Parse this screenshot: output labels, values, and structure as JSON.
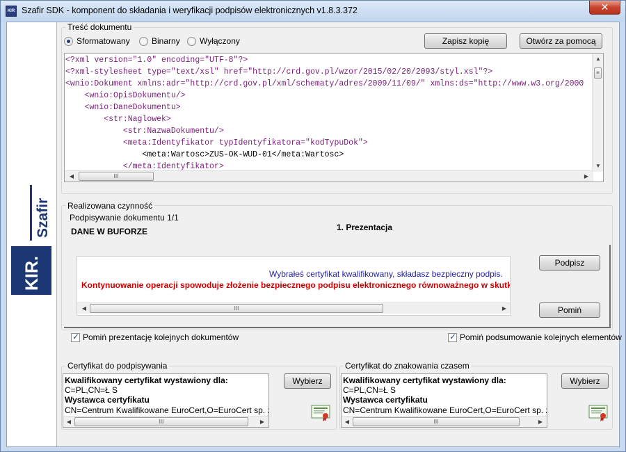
{
  "window": {
    "title": "Szafir SDK - komponent do składania i weryfikacji podpisów elektronicznych v1.8.3.372",
    "icon_label": "KIR",
    "close_label": "✕"
  },
  "logo": {
    "brand": "Szafir",
    "org": "KIR."
  },
  "document_content": {
    "group_title": "Treść dokumentu",
    "radio_formatted": "Sformatowany",
    "radio_binary": "Binarny",
    "radio_off": "Wyłączony",
    "selected": "Sformatowany",
    "save_copy_button": "Zapisz kopię",
    "open_with_button": "Otwórz za pomocą",
    "xml_lines": [
      "<?xml version=\"1.0\" encoding=\"UTF-8\"?>",
      "<?xml-stylesheet type=\"text/xsl\" href=\"http://crd.gov.pl/wzor/2015/02/20/2093/styl.xsl\"?>",
      "<wnio:Dokument xmlns:adr=\"http://crd.gov.pl/xml/schematy/adres/2009/11/09/\" xmlns:ds=\"http://www.w3.org/2000",
      "    <wnio:OpisDokumentu/>",
      "    <wnio:DaneDokumentu>",
      "        <str:Naglowek>",
      "            <str:NazwaDokumentu/>",
      "            <meta:Identyfikator typIdentyfikatora=\"kodTypuDok\">",
      "                <meta:Wartosc>ZUS-OK-WUD-01</meta:Wartosc>",
      "            </meta:Identyfikator>"
    ]
  },
  "activity": {
    "group_title": "Realizowana czynność",
    "progress_label": "Podpisywanie dokumentu 1/1",
    "buffer_label": "DANE W BUFORZE",
    "step_label": "1. Prezentacja",
    "info_message": "Wybrałeś certyfikat kwalifikowany, składasz bezpieczny podpis.",
    "warning_message": "Kontynuowanie operacji spowoduje złożenie bezpiecznego podpisu elektronicznego równoważnego w skutkach",
    "sign_button": "Podpisz",
    "skip_button": "Pomiń"
  },
  "options": {
    "skip_presentation": {
      "label": "Pomiń prezentację kolejnych dokumentów",
      "checked": true
    },
    "skip_summary": {
      "label": "Pomiń podsumowanie kolejnych elementów",
      "checked": true
    }
  },
  "signing_cert": {
    "group_title": "Certyfikat do podpisywania",
    "heading": "Kwalifikowany certyfikat wystawiony dla:",
    "subject": "C=PL,CN=Ł         S",
    "issuer_heading": "Wystawca certyfikatu",
    "issuer": "CN=Centrum Kwalifikowane EuroCert,O=EuroCert sp. z o.o.,",
    "choose_button": "Wybierz"
  },
  "timestamp_cert": {
    "group_title": "Certyfikat do znakowania czasem",
    "heading": "Kwalifikowany certyfikat wystawiony dla:",
    "subject": "C=PL,CN=Ł         S",
    "issuer_heading": "Wystawca certyfikatu",
    "issuer": "CN=Centrum Kwalifikowane EuroCert,O=EuroCert sp. z o.o.,",
    "choose_button": "Wybierz"
  },
  "scroll": {
    "thumb_grip": "III",
    "left": "◀",
    "right": "▶",
    "up": "▲",
    "down": "▼"
  },
  "colors": {
    "accent": "#1d3775",
    "warning": "#cc0000",
    "info": "#1f1fa8"
  }
}
